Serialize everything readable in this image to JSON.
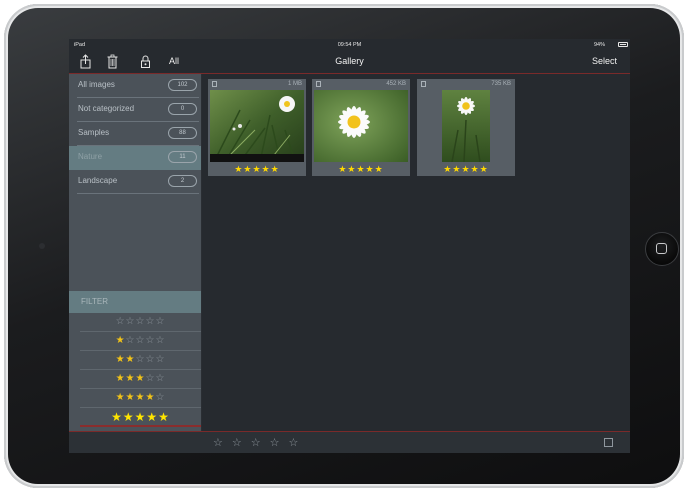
{
  "statusbar": {
    "device": "iPad",
    "time": "09:54 PM",
    "battery": "94%",
    "battery_level": 0.94
  },
  "navbar": {
    "title": "Gallery",
    "all_label": "All",
    "select_label": "Select"
  },
  "sidebar": {
    "categories": [
      {
        "label": "All images",
        "count": "102"
      },
      {
        "label": "Not categorized",
        "count": "0"
      },
      {
        "label": "Samples",
        "count": "88"
      },
      {
        "label": "Nature",
        "count": "11"
      },
      {
        "label": "Landscape",
        "count": "2"
      }
    ],
    "selected": "Nature",
    "filter_label": "FILTER",
    "filter_rows": [
      {
        "rating": 0,
        "on": "",
        "off": "☆☆☆☆☆"
      },
      {
        "rating": 1,
        "on": "★",
        "off": "☆☆☆☆"
      },
      {
        "rating": 2,
        "on": "★★",
        "off": "☆☆☆"
      },
      {
        "rating": 3,
        "on": "★★★",
        "off": "☆☆"
      },
      {
        "rating": 4,
        "on": "★★★★",
        "off": "☆"
      },
      {
        "rating": 5,
        "on": "★★★★★",
        "off": ""
      }
    ]
  },
  "gallery": {
    "images": [
      {
        "size": "1 MB",
        "rating": 5,
        "stars": "★★★★★",
        "subject": "daisy"
      },
      {
        "size": "452 KB",
        "rating": 5,
        "stars": "★★★★★",
        "subject": "daisy"
      },
      {
        "size": "735 KB",
        "rating": 5,
        "stars": "★★★★★",
        "subject": "daisy"
      }
    ]
  },
  "toolbar": {
    "rating_stars": "☆☆☆☆☆",
    "share_icon": "share-icon"
  },
  "icons": {
    "share": "share-icon",
    "trash": "trash-icon",
    "lock": "lock-icon"
  },
  "colors": {
    "accent": "#ffd800",
    "selected_row": "#647c82",
    "divider_red": "#7a2a2a"
  }
}
